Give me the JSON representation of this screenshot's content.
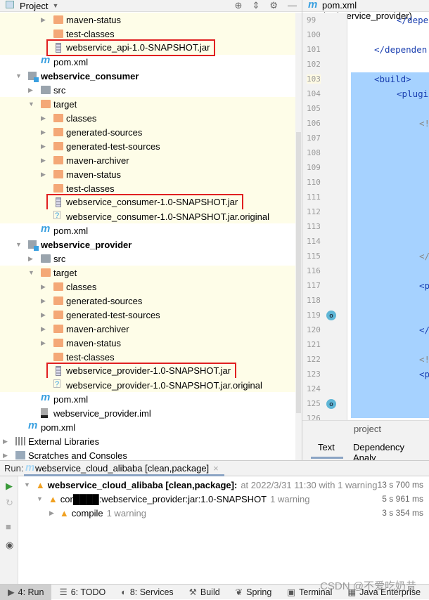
{
  "project": {
    "title": "Project",
    "tree": [
      {
        "label": "maven-status",
        "icon": "folder",
        "level": 3,
        "arrow": "collapsed",
        "hl": true
      },
      {
        "label": "test-classes",
        "icon": "folder",
        "level": 3,
        "hl": true
      },
      {
        "label": "webservice_api-1.0-SNAPSHOT.jar",
        "icon": "jar",
        "level": 3,
        "hl": true,
        "boxed": true
      },
      {
        "label": "pom.xml",
        "icon": "maven",
        "level": 2
      },
      {
        "label": "webservice_consumer",
        "icon": "module",
        "level": 1,
        "arrow": "expanded",
        "bold": true
      },
      {
        "label": "src",
        "icon": "folder-grey",
        "level": 2,
        "arrow": "collapsed"
      },
      {
        "label": "target",
        "icon": "folder",
        "level": 2,
        "arrow": "expanded",
        "hl": true
      },
      {
        "label": "classes",
        "icon": "folder",
        "level": 3,
        "arrow": "collapsed",
        "hl": true
      },
      {
        "label": "generated-sources",
        "icon": "folder",
        "level": 3,
        "arrow": "collapsed",
        "hl": true
      },
      {
        "label": "generated-test-sources",
        "icon": "folder",
        "level": 3,
        "arrow": "collapsed",
        "hl": true
      },
      {
        "label": "maven-archiver",
        "icon": "folder",
        "level": 3,
        "arrow": "collapsed",
        "hl": true
      },
      {
        "label": "maven-status",
        "icon": "folder",
        "level": 3,
        "arrow": "collapsed",
        "hl": true
      },
      {
        "label": "test-classes",
        "icon": "folder",
        "level": 3,
        "hl": true
      },
      {
        "label": "webservice_consumer-1.0-SNAPSHOT.jar",
        "icon": "jar",
        "level": 3,
        "hl": true,
        "boxed": true
      },
      {
        "label": "webservice_consumer-1.0-SNAPSHOT.jar.original",
        "icon": "unknown-file",
        "level": 3,
        "hl": true
      },
      {
        "label": "pom.xml",
        "icon": "maven",
        "level": 2
      },
      {
        "label": "webservice_provider",
        "icon": "module",
        "level": 1,
        "arrow": "expanded",
        "bold": true
      },
      {
        "label": "src",
        "icon": "folder-grey",
        "level": 2,
        "arrow": "collapsed"
      },
      {
        "label": "target",
        "icon": "folder",
        "level": 2,
        "arrow": "expanded",
        "hl": true
      },
      {
        "label": "classes",
        "icon": "folder",
        "level": 3,
        "arrow": "collapsed",
        "hl": true
      },
      {
        "label": "generated-sources",
        "icon": "folder",
        "level": 3,
        "arrow": "collapsed",
        "hl": true
      },
      {
        "label": "generated-test-sources",
        "icon": "folder",
        "level": 3,
        "arrow": "collapsed",
        "hl": true
      },
      {
        "label": "maven-archiver",
        "icon": "folder",
        "level": 3,
        "arrow": "collapsed",
        "hl": true
      },
      {
        "label": "maven-status",
        "icon": "folder",
        "level": 3,
        "arrow": "collapsed",
        "hl": true
      },
      {
        "label": "test-classes",
        "icon": "folder",
        "level": 3,
        "hl": true
      },
      {
        "label": "webservice_provider-1.0-SNAPSHOT.jar",
        "icon": "jar",
        "level": 3,
        "hl": true,
        "boxed": true
      },
      {
        "label": "webservice_provider-1.0-SNAPSHOT.jar.original",
        "icon": "unknown-file",
        "level": 3,
        "hl": true
      },
      {
        "label": "pom.xml",
        "icon": "maven",
        "level": 2
      },
      {
        "label": "webservice_provider.iml",
        "icon": "iml-file",
        "level": 2
      },
      {
        "label": "pom.xml",
        "icon": "maven",
        "level": 1
      },
      {
        "label": "External Libraries",
        "icon": "libraries",
        "level": 0,
        "arrow": "collapsed"
      },
      {
        "label": "Scratches and Consoles",
        "icon": "scratches",
        "level": 0,
        "arrow": "collapsed"
      }
    ]
  },
  "editor": {
    "tab": "pom.xml (webservice_provider)",
    "first_line": 99,
    "last_line": 126,
    "code": [
      {
        "line": 99,
        "text": "</depe"
      },
      {
        "line": 101,
        "text": "</dependen"
      },
      {
        "line": 103,
        "text": "<build>"
      },
      {
        "line": 104,
        "text": "<plugi"
      },
      {
        "line": 106,
        "text": "<!",
        "comment": true
      },
      {
        "line": 115,
        "text": "</",
        "comment": true
      },
      {
        "line": 117,
        "text": "<p"
      },
      {
        "line": 120,
        "text": "</"
      },
      {
        "line": 122,
        "text": "<!",
        "comment": true
      },
      {
        "line": 123,
        "text": "<p"
      }
    ],
    "override_lines": [
      119,
      125
    ],
    "bottom_tabs": {
      "project": "project",
      "text": "Text",
      "dependency": "Dependency Analy"
    }
  },
  "run": {
    "label": "Run:",
    "tab": "webservice_cloud_alibaba [clean,package]",
    "rows": [
      {
        "name": "webservice_cloud_alibaba [clean,package]:",
        "detail": "at 2022/3/31 11:30 with 1 warning",
        "duration": "13 s 700 ms"
      },
      {
        "name": "cor████:webservice_provider:jar:1.0-SNAPSHOT",
        "detail": "1 warning",
        "duration": "5 s 961 ms"
      },
      {
        "name": "compile",
        "detail": "1 warning",
        "duration": "3 s 354 ms"
      }
    ]
  },
  "bottom_bar": [
    {
      "label": "4: Run",
      "icon": "play"
    },
    {
      "label": "6: TODO",
      "icon": "list"
    },
    {
      "label": "8: Services",
      "icon": "services"
    },
    {
      "label": "Build",
      "icon": "hammer"
    },
    {
      "label": "Spring",
      "icon": "leaf"
    },
    {
      "label": "Terminal",
      "icon": "terminal"
    },
    {
      "label": "Java Enterprise",
      "icon": "java-ee"
    }
  ],
  "watermark": "CSDN @不爱吃奶昔",
  "colors": {
    "highlight_row": "#fefde8",
    "selection": "#a6d2ff",
    "box": "#e02020",
    "folder": "#f4a877"
  }
}
